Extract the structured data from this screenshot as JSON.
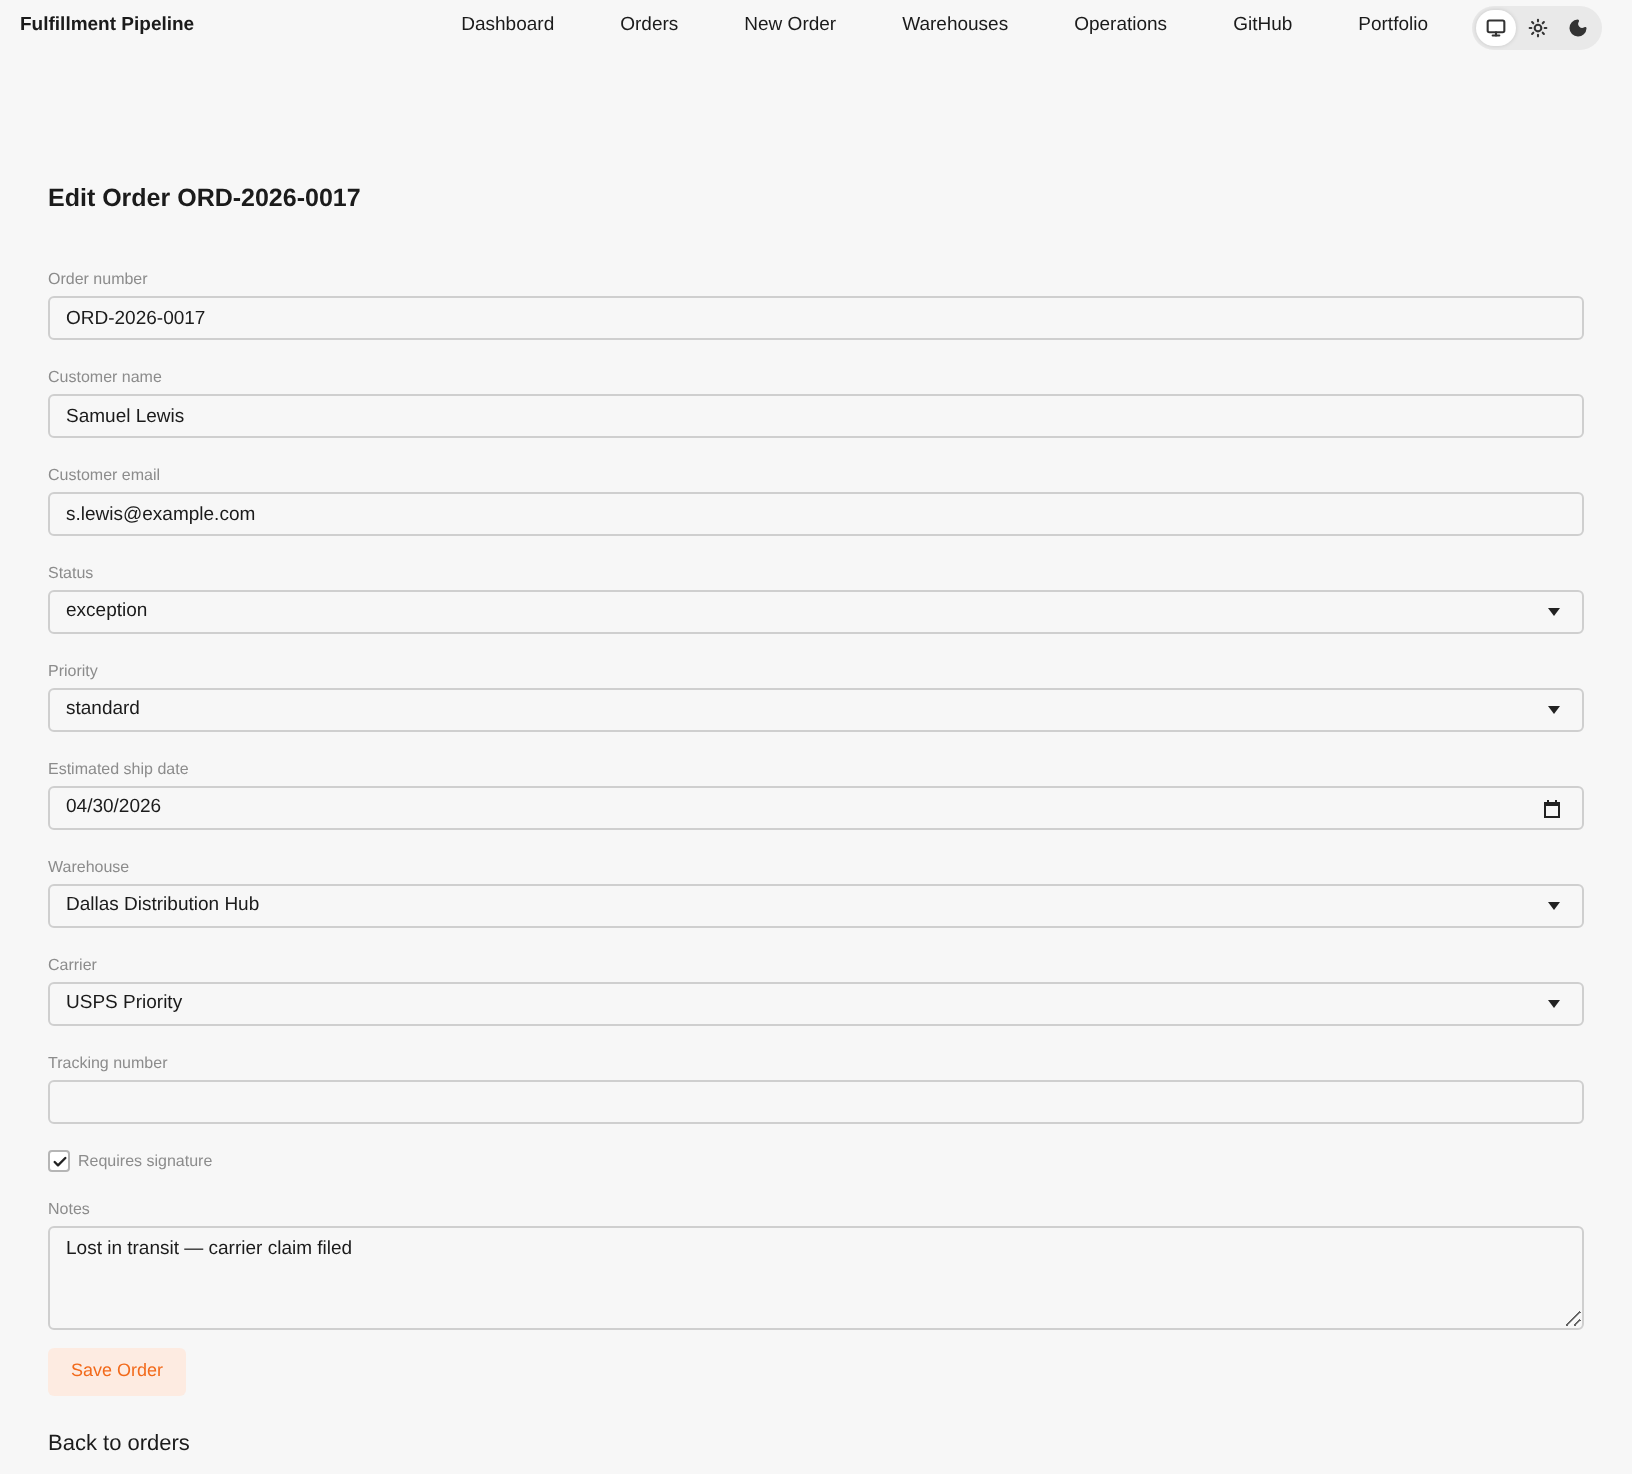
{
  "nav": {
    "brand": "Fulfillment Pipeline",
    "links": [
      {
        "label": "Dashboard"
      },
      {
        "label": "Orders"
      },
      {
        "label": "New Order"
      },
      {
        "label": "Warehouses"
      },
      {
        "label": "Operations"
      },
      {
        "label": "GitHub"
      },
      {
        "label": "Portfolio"
      }
    ],
    "theme_options": [
      {
        "kind": "system",
        "selected": true
      },
      {
        "kind": "light",
        "selected": false
      },
      {
        "kind": "dark",
        "selected": false
      }
    ]
  },
  "form": {
    "title": "Edit Order ORD-2026-0017",
    "fields": [
      {
        "kind": "text",
        "label": "Order number",
        "value": "ORD-2026-0017"
      },
      {
        "kind": "text",
        "label": "Customer name",
        "value": "Samuel Lewis"
      },
      {
        "kind": "text",
        "label": "Customer email",
        "value": "s.lewis@example.com"
      },
      {
        "kind": "select",
        "label": "Status",
        "value": "exception"
      },
      {
        "kind": "select",
        "label": "Priority",
        "value": "standard"
      },
      {
        "kind": "date",
        "label": "Estimated ship date",
        "value": "04/30/2026"
      },
      {
        "kind": "select",
        "label": "Warehouse",
        "value": "Dallas Distribution Hub"
      },
      {
        "kind": "select",
        "label": "Carrier",
        "value": "USPS Priority"
      },
      {
        "kind": "text",
        "label": "Tracking number"
      },
      {
        "kind": "checkbox",
        "label": "Requires signature",
        "checked": true
      },
      {
        "kind": "textarea",
        "label": "Notes",
        "value": "Lost in transit — carrier claim filed"
      }
    ],
    "submit": "Save Order",
    "back_link": "Back to orders"
  }
}
